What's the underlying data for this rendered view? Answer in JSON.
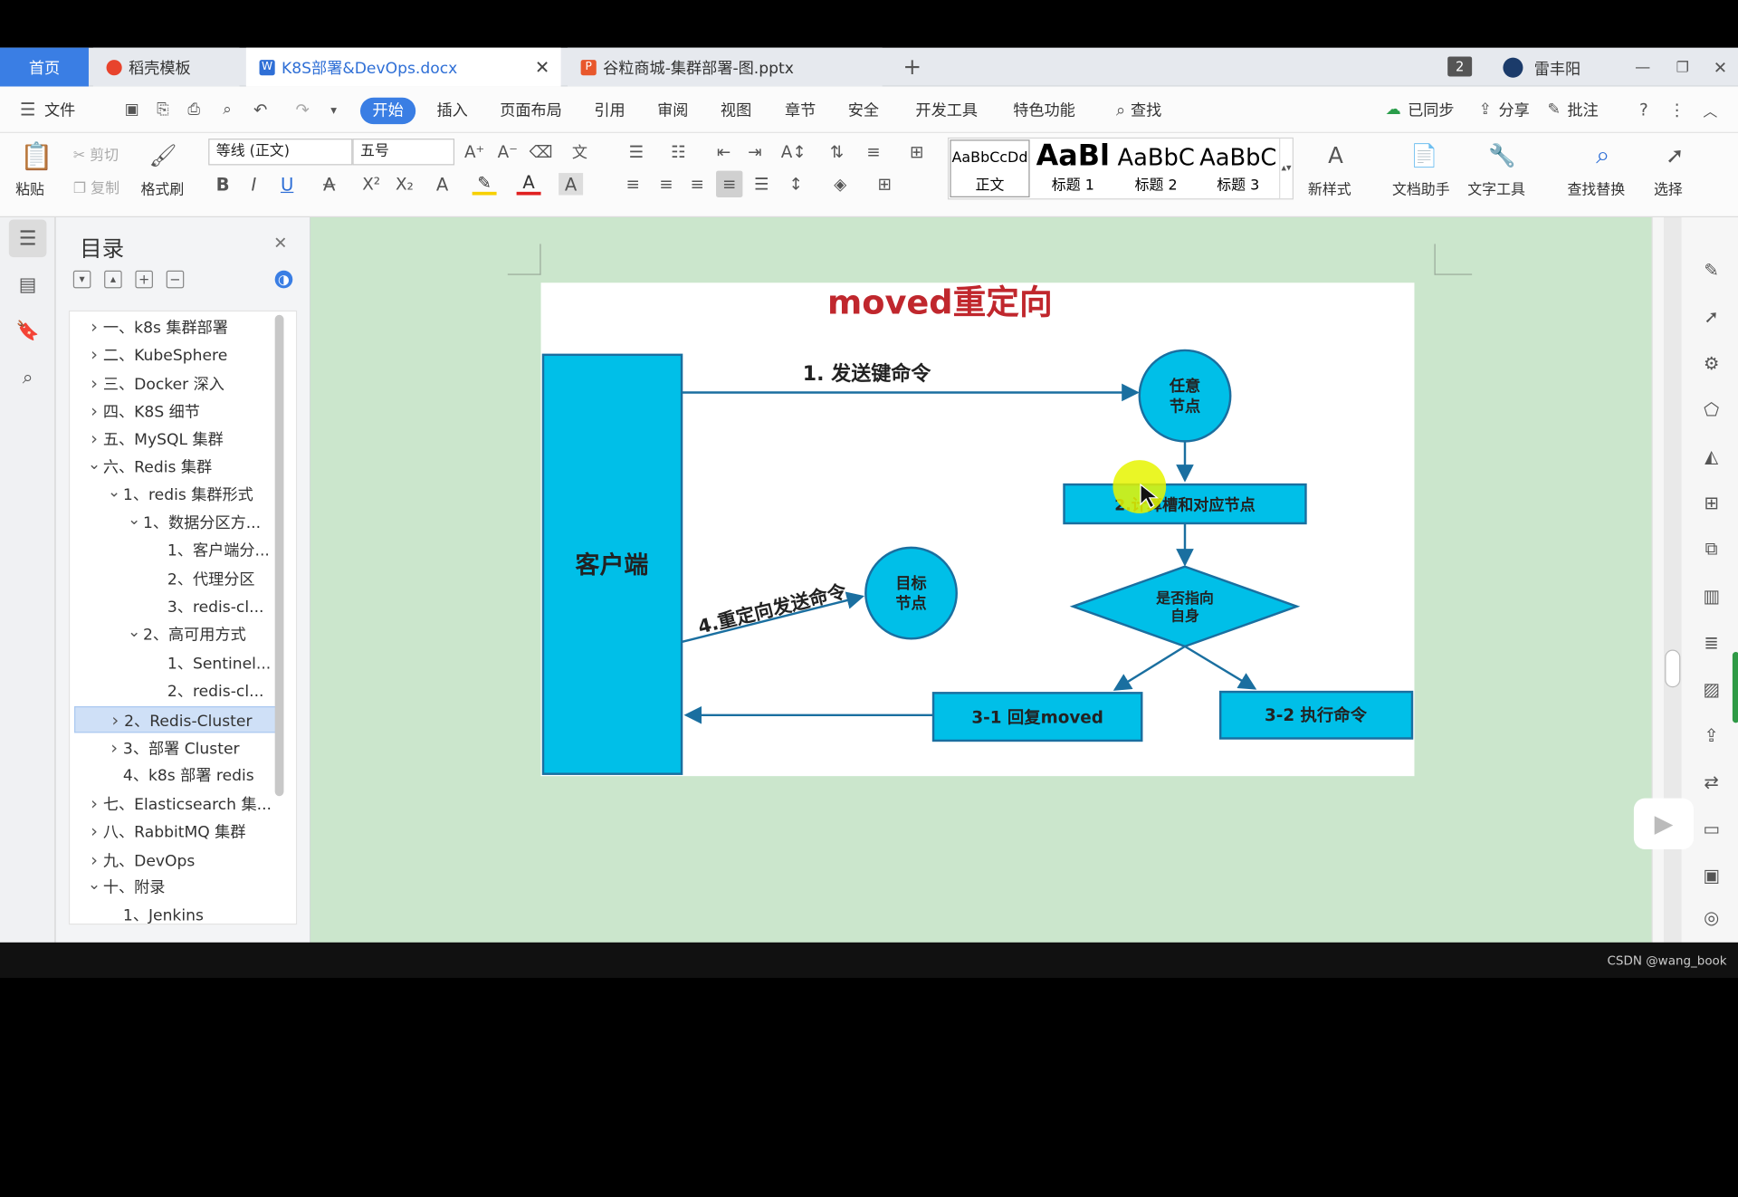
{
  "tabs": [
    {
      "label": "首页"
    },
    {
      "label": "稻壳模板"
    },
    {
      "label": "K8S部署&DevOps.docx"
    },
    {
      "label": "谷粒商城-集群部署-图.pptx"
    }
  ],
  "tab_badge": "2",
  "user": {
    "name": "雷丰阳"
  },
  "menu": {
    "file": "文件",
    "items": [
      "开始",
      "插入",
      "页面布局",
      "引用",
      "审阅",
      "视图",
      "章节",
      "安全",
      "开发工具",
      "特色功能"
    ],
    "active": "开始",
    "search": "查找",
    "sync": "已同步",
    "share": "分享",
    "comment": "批注"
  },
  "ribbon": {
    "paste": "粘贴",
    "cut": "剪切",
    "copy": "复制",
    "format_painter": "格式刷",
    "font_name": "等线 (正文)",
    "font_size": "五号",
    "styles": [
      {
        "sample": "AaBbCcDd",
        "name": "正文"
      },
      {
        "sample": "AaBl",
        "name": "标题 1"
      },
      {
        "sample": "AaBbC",
        "name": "标题 2"
      },
      {
        "sample": "AaBbC",
        "name": "标题 3"
      }
    ],
    "new_style": "新样式",
    "doc_helper": "文档助手",
    "text_tools": "文字工具",
    "find_replace": "查找替换",
    "select": "选择"
  },
  "sidebar": {
    "title": "目录",
    "toc": [
      {
        "label": "一、k8s 集群部署",
        "level": 0,
        "state": "collapsed"
      },
      {
        "label": "二、KubeSphere",
        "level": 0,
        "state": "collapsed"
      },
      {
        "label": "三、Docker 深入",
        "level": 0,
        "state": "collapsed"
      },
      {
        "label": "四、K8S 细节",
        "level": 0,
        "state": "collapsed"
      },
      {
        "label": "五、MySQL 集群",
        "level": 0,
        "state": "collapsed"
      },
      {
        "label": "六、Redis 集群",
        "level": 0,
        "state": "expanded"
      },
      {
        "label": "1、redis 集群形式",
        "level": 1,
        "state": "expanded"
      },
      {
        "label": "1、数据分区方...",
        "level": 2,
        "state": "expanded"
      },
      {
        "label": "1、客户端分...",
        "level": 3,
        "state": "none"
      },
      {
        "label": "2、代理分区",
        "level": 3,
        "state": "none"
      },
      {
        "label": "3、redis-cl...",
        "level": 3,
        "state": "none"
      },
      {
        "label": "2、高可用方式",
        "level": 2,
        "state": "expanded"
      },
      {
        "label": "1、Sentinel...",
        "level": 3,
        "state": "none"
      },
      {
        "label": "2、redis-cl...",
        "level": 3,
        "state": "none"
      },
      {
        "label": "2、Redis-Cluster",
        "level": 1,
        "state": "collapsed",
        "selected": true
      },
      {
        "label": "3、部署 Cluster",
        "level": 1,
        "state": "collapsed"
      },
      {
        "label": "4、k8s 部署 redis",
        "level": 1,
        "state": "none"
      },
      {
        "label": "七、Elasticsearch 集...",
        "level": 0,
        "state": "collapsed"
      },
      {
        "label": "八、RabbitMQ 集群",
        "level": 0,
        "state": "collapsed"
      },
      {
        "label": "九、DevOps",
        "level": 0,
        "state": "collapsed"
      },
      {
        "label": "十、附录",
        "level": 0,
        "state": "expanded"
      },
      {
        "label": "1、Jenkins",
        "level": 1,
        "state": "none"
      }
    ]
  },
  "diagram": {
    "title": "moved重定向",
    "client": "客户端",
    "step1": "1. 发送键命令",
    "any_node": [
      "任意",
      "节点"
    ],
    "step2": "2.计算槽和对应节点",
    "decision": [
      "是否指向",
      "自身"
    ],
    "reply_moved": "3-1 回复moved",
    "exec": "3-2 执行命令",
    "redirect": "4.重定向发送命令",
    "target_node": [
      "目标",
      "节点"
    ]
  },
  "watermark": "CSDN @wang_book",
  "colors": {
    "accent": "#3a7ee4",
    "diagram_fill": "#00bfe8",
    "diagram_stroke": "#1a6fa0",
    "title_red": "#c0272d",
    "doc_bg": "#cbe6cc"
  }
}
